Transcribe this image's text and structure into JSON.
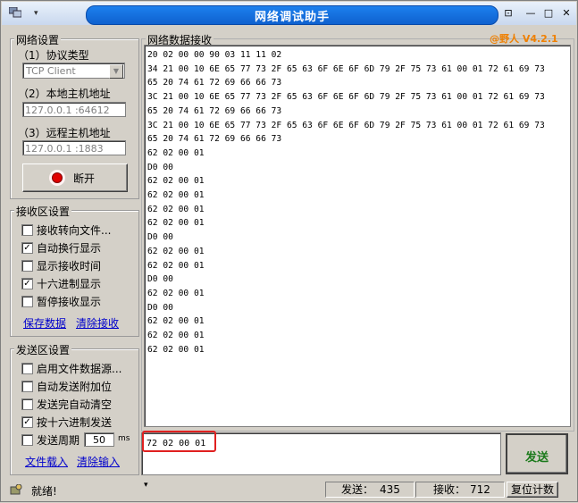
{
  "window": {
    "title": "网络调试助手",
    "version": "@野人 V4.2.1",
    "sysmenu_glyph": "▾",
    "controls": {
      "pin_glyph": "⊡",
      "minimize_glyph": "—",
      "maximize_glyph": "□",
      "close_glyph": "✕"
    }
  },
  "network": {
    "legend": "网络设置",
    "protocol_label": "（1）协议类型",
    "protocol_value": "TCP Client",
    "local_label": "（2）本地主机地址",
    "local_value": "127.0.0.1 :64612",
    "remote_label": "（3）远程主机地址",
    "remote_value": "127.0.0.1 :1883",
    "connect_button": "断开"
  },
  "receive": {
    "legend": "接收区设置",
    "options": [
      {
        "label": "接收转向文件...",
        "checked": false
      },
      {
        "label": "自动换行显示",
        "checked": true
      },
      {
        "label": "显示接收时间",
        "checked": false
      },
      {
        "label": "十六进制显示",
        "checked": true
      },
      {
        "label": "暂停接收显示",
        "checked": false
      }
    ],
    "save_link": "保存数据",
    "clear_link": "清除接收"
  },
  "send": {
    "legend": "发送区设置",
    "options": [
      {
        "label": "启用文件数据源...",
        "checked": false
      },
      {
        "label": "自动发送附加位",
        "checked": false
      },
      {
        "label": "发送完自动清空",
        "checked": false
      },
      {
        "label": "按十六进制发送",
        "checked": true
      },
      {
        "label": "发送周期",
        "checked": false
      }
    ],
    "period_value": "50",
    "period_unit": "ms",
    "load_link": "文件载入",
    "clear_link": "清除输入",
    "input_value": "72 02 00 01",
    "send_button": "发送"
  },
  "recv_area": {
    "title": "网络数据接收",
    "lines": [
      "20 02 00 00 90 03 11 11 02",
      "34 21 00 10 6E 65 77 73 2F 65 63 6F 6E 6F 6D 79 2F 75 73 61 00 01 72 61 69 73",
      "65 20 74 61 72 69 66 66 73",
      "3C 21 00 10 6E 65 77 73 2F 65 63 6F 6E 6F 6D 79 2F 75 73 61 00 01 72 61 69 73",
      "65 20 74 61 72 69 66 66 73",
      "3C 21 00 10 6E 65 77 73 2F 65 63 6F 6E 6F 6D 79 2F 75 73 61 00 01 72 61 69 73",
      "65 20 74 61 72 69 66 66 73",
      "62 02 00 01",
      "D0 00",
      "62 02 00 01",
      "62 02 00 01",
      "62 02 00 01",
      "62 02 00 01",
      "D0 00",
      "62 02 00 01",
      "62 02 00 01",
      "D0 00",
      "62 02 00 01",
      "D0 00",
      "62 02 00 01",
      "62 02 00 01",
      "62 02 00 01"
    ]
  },
  "status": {
    "ready": "就绪!",
    "sent_label": "发送：",
    "sent_value": "435",
    "recv_label": "接收：",
    "recv_value": "712",
    "reset_button": "复位计数"
  }
}
